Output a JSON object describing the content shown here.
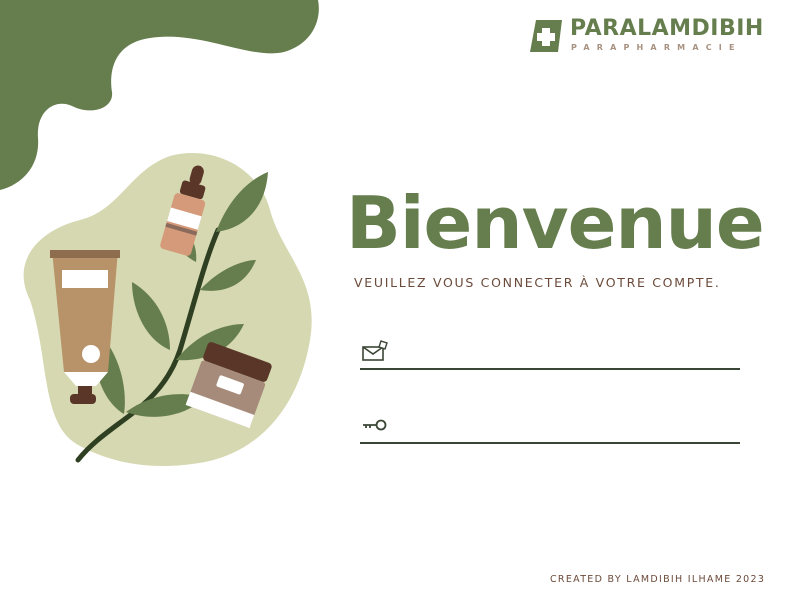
{
  "brand": {
    "name": "PARALAMDIBIH",
    "tagline": "PARAPHARMACIE",
    "primary_color": "#667e4d",
    "soft_color": "#a89281",
    "blob_color": "#d5d8b0",
    "dark_text_color": "#6b4a3a"
  },
  "login": {
    "heading": "Bienvenue",
    "subtitle": "VEUILLEZ VOUS CONNECTER À VOTRE COMPTE.",
    "email_field": {
      "value": "",
      "placeholder": "",
      "icon": "envelope-icon"
    },
    "password_field": {
      "value": "",
      "placeholder": "",
      "icon": "key-icon"
    }
  },
  "footer": {
    "credit": "CREATED BY LAMDIBIH ILHAME 2023"
  }
}
